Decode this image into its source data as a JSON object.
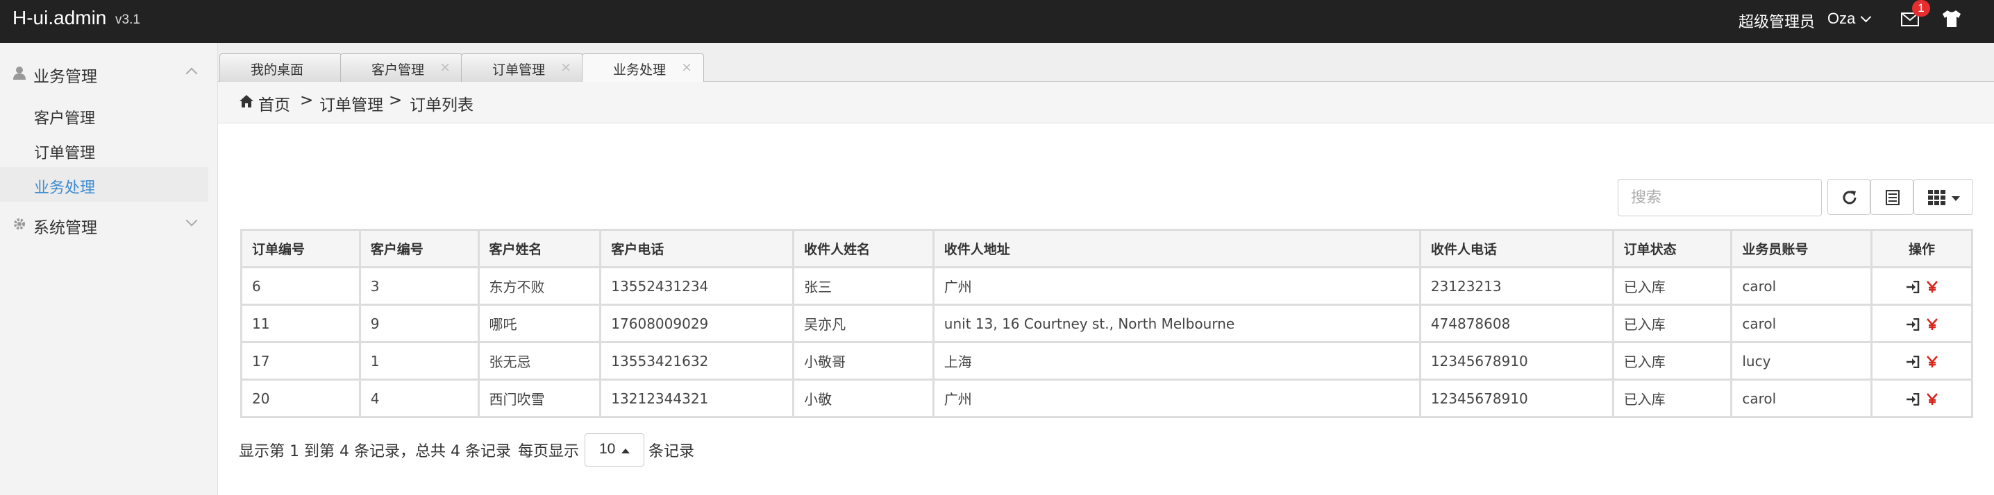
{
  "header": {
    "logo": "H-ui.admin",
    "version": "v3.1",
    "user_role": "超级管理员",
    "user_name": "Oza",
    "mail_badge": "1"
  },
  "sidebar": {
    "groups": [
      {
        "label": "业务管理",
        "icon": "user-icon",
        "expanded": true,
        "items": [
          {
            "label": "客户管理"
          },
          {
            "label": "订单管理"
          },
          {
            "label": "业务处理",
            "active": true
          }
        ]
      },
      {
        "label": "系统管理",
        "icon": "gear-icon",
        "expanded": false
      }
    ]
  },
  "tabs": [
    {
      "label": "我的桌面",
      "closable": false
    },
    {
      "label": "客户管理",
      "closable": true
    },
    {
      "label": "订单管理",
      "closable": true
    },
    {
      "label": "业务处理",
      "closable": true,
      "active": true
    }
  ],
  "tab_close_glyph": "×",
  "breadcrumb": {
    "items": [
      "首页",
      "订单管理",
      "订单列表"
    ],
    "separator": ">"
  },
  "toolbar": {
    "search_placeholder": "搜索"
  },
  "table": {
    "columns": [
      "订单编号",
      "客户编号",
      "客户姓名",
      "客户电话",
      "收件人姓名",
      "收件人地址",
      "收件人电话",
      "订单状态",
      "业务员账号",
      "操作"
    ],
    "rows": [
      [
        "6",
        "3",
        "东方不败",
        "13552431234",
        "张三",
        "广州",
        "23123213",
        "已入库",
        "carol"
      ],
      [
        "11",
        "9",
        "哪吒",
        "17608009029",
        "吴亦凡",
        "unit 13, 16 Courtney st., North Melbourne",
        "474878608",
        "已入库",
        "carol"
      ],
      [
        "17",
        "1",
        "张无忌",
        "13553421632",
        "小敬哥",
        "上海",
        "12345678910",
        "已入库",
        "lucy"
      ],
      [
        "20",
        "4",
        "西门吹雪",
        "13212344321",
        "小敬",
        "广州",
        "12345678910",
        "已入库",
        "carol"
      ]
    ]
  },
  "pagination": {
    "summary": "显示第 1 到第 4 条记录，总共 4 条记录",
    "per_page_prefix": "每页显示",
    "page_size": "10",
    "per_page_suffix": "条记录"
  },
  "colors": {
    "topbar": "#222222",
    "accent": "#3d8bd3",
    "badge": "#e62e2e",
    "yen": "#d9261c"
  }
}
